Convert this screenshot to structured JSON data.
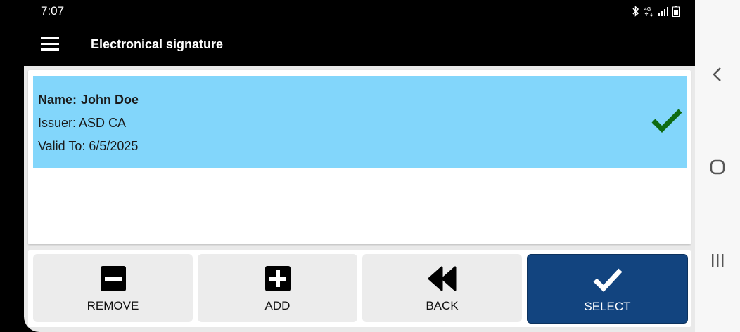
{
  "status_bar": {
    "time": "7:07",
    "icons": [
      "bluetooth-icon",
      "4g-icon",
      "signal-icon",
      "battery-icon"
    ],
    "network_label": "4G"
  },
  "app_bar": {
    "title": "Electronical signature",
    "menu_icon": "hamburger-menu-icon"
  },
  "certificates": [
    {
      "name_label": "Name:",
      "name_value": "John Doe",
      "issuer": "Issuer: ASD CA",
      "valid_to": "Valid To: 6/5/2025",
      "selected": true,
      "check_icon": "checkmark-icon"
    }
  ],
  "toolbar": {
    "remove_label": "REMOVE",
    "add_label": "ADD",
    "back_label": "BACK",
    "select_label": "SELECT"
  },
  "nav_bar": {
    "buttons": [
      "back-icon",
      "home-icon",
      "recents-icon"
    ]
  },
  "colors": {
    "selected_row": "#82d6fb",
    "check": "#0e6b12",
    "primary_button": "#12447f",
    "button_bg": "#ececec",
    "app_bar": "#000000"
  }
}
